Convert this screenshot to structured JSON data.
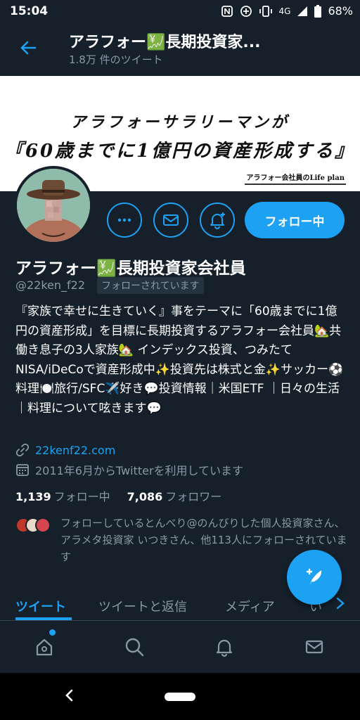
{
  "status_bar": {
    "time": "15:04",
    "network": "4G",
    "battery": "68%",
    "icons": [
      "nfc-icon",
      "data-saver-icon",
      "vibrate-icon",
      "signal-icon",
      "battery-icon"
    ]
  },
  "header": {
    "back_icon": "back-arrow-icon",
    "title": "アラフォー💹長期投資家...",
    "subtitle": "1.8万 件のツイート"
  },
  "banner": {
    "line1": "アラフォーサラリーマンが",
    "line2": "『60歳までに1億円の資産形成する』",
    "tag": "アラフォー会社員のLife plan"
  },
  "actions": {
    "more_icon": "more-icon",
    "mail_icon": "mail-icon",
    "notify_icon": "bell-plus-icon",
    "follow_label": "フォロー中"
  },
  "profile": {
    "name": "アラフォー💹長期投資家会社員",
    "handle": "@22ken_f22",
    "follows_you": "フォローされています",
    "bio": "『家族で幸せに生きていく』事をテーマに「60歳までに1億円の資産形成」を目標に長期投資するアラフォー会社員🏡共働き息子の3人家族🏡 インデックス投資、つみたてNISA/iDeCoで資産形成中✨投資先は株式と金✨サッカー⚽料理🍽️旅行/SFC✈️好き💬投資情報｜米国ETF ｜日々の生活｜料理について呟きます💬",
    "link": "22kenf22.com",
    "joined": "2011年6月からTwitterを利用しています",
    "following_count": "1,139",
    "following_label": "フォロー中",
    "followers_count": "7,086",
    "followers_label": "フォロワー",
    "followed_by": "フォローしているとんべり@のんびりした個人投資家さん、アラメタ投資家 いつきさん、他113人にフォローされています"
  },
  "tabs": [
    {
      "label": "ツイート",
      "active": true
    },
    {
      "label": "ツイートと返信",
      "active": false
    },
    {
      "label": "メディア",
      "active": false
    },
    {
      "label": "い",
      "active": false
    }
  ],
  "bottom_nav": [
    "home-icon",
    "search-icon",
    "bell-icon",
    "mail-icon"
  ],
  "colors": {
    "background": "#15202b",
    "accent": "#1da1f2",
    "secondary_text": "#8899a6"
  }
}
